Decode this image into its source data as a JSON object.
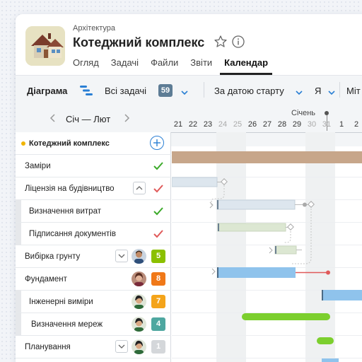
{
  "header": {
    "breadcrumb": "Архітектура",
    "title": "Котеджний комплекс",
    "tabs": [
      {
        "label": "Огляд",
        "active": false
      },
      {
        "label": "Задачі",
        "active": false
      },
      {
        "label": "Файли",
        "active": false
      },
      {
        "label": "Звіти",
        "active": false
      },
      {
        "label": "Календар",
        "active": true
      }
    ]
  },
  "toolbar": {
    "view_label": "Діаграма",
    "filter_label": "Всі задачі",
    "filter_count": "59",
    "sort_label": "За датою старту",
    "assignee_label": "Я",
    "extra_label": "Міт"
  },
  "timeline": {
    "range_label": "Січ — Лют",
    "month_label": "Січень",
    "days": [
      "21",
      "22",
      "23",
      "24",
      "25",
      "26",
      "27",
      "28",
      "29",
      "30",
      "31",
      "1",
      "2"
    ],
    "weekend_days": [
      "24",
      "25",
      "30",
      "31"
    ]
  },
  "tasks": [
    {
      "label": "Котеджний комплекс",
      "type": "project"
    },
    {
      "label": "Заміри",
      "status": "done"
    },
    {
      "label": "Ліцензія на будівництво",
      "status": "rejected",
      "expandable": true
    },
    {
      "label": "Визначення витрат",
      "status": "done",
      "subtask": true
    },
    {
      "label": "Підписання документів",
      "status": "rejected",
      "subtask": true
    },
    {
      "label": "Вибірка грунту",
      "badge": "5",
      "badge_color": "#8bc000",
      "expandable": true
    },
    {
      "label": "Фундамент",
      "badge": "8",
      "badge_color": "#f07818"
    },
    {
      "label": "Інженерні виміри",
      "badge": "7",
      "badge_color": "#f4a41a",
      "subtask": true
    },
    {
      "label": "Визначення мереж",
      "badge": "4",
      "badge_color": "#4ea7a0",
      "subtask": true
    },
    {
      "label": "Планування",
      "badge": "1",
      "badge_color": "#d4d7da",
      "expandable": true
    }
  ],
  "colors": {
    "accent": "#2a7fd4",
    "project_bar": "#c7a68a",
    "done_check": "#3caa2a",
    "rejected_check": "#e05a5a",
    "bar_grey_blue": "#dde6ee",
    "bar_light_green": "#dce7d2",
    "bar_blue": "#8fc3ec",
    "bar_green": "#7ccf2e"
  },
  "icons": [
    "house-icon",
    "star-icon",
    "info-icon",
    "diagram-icon",
    "chevron-down-icon",
    "chevron-left-icon",
    "chevron-right-icon",
    "add-icon",
    "check-icon",
    "chevron-up-icon",
    "avatar"
  ]
}
